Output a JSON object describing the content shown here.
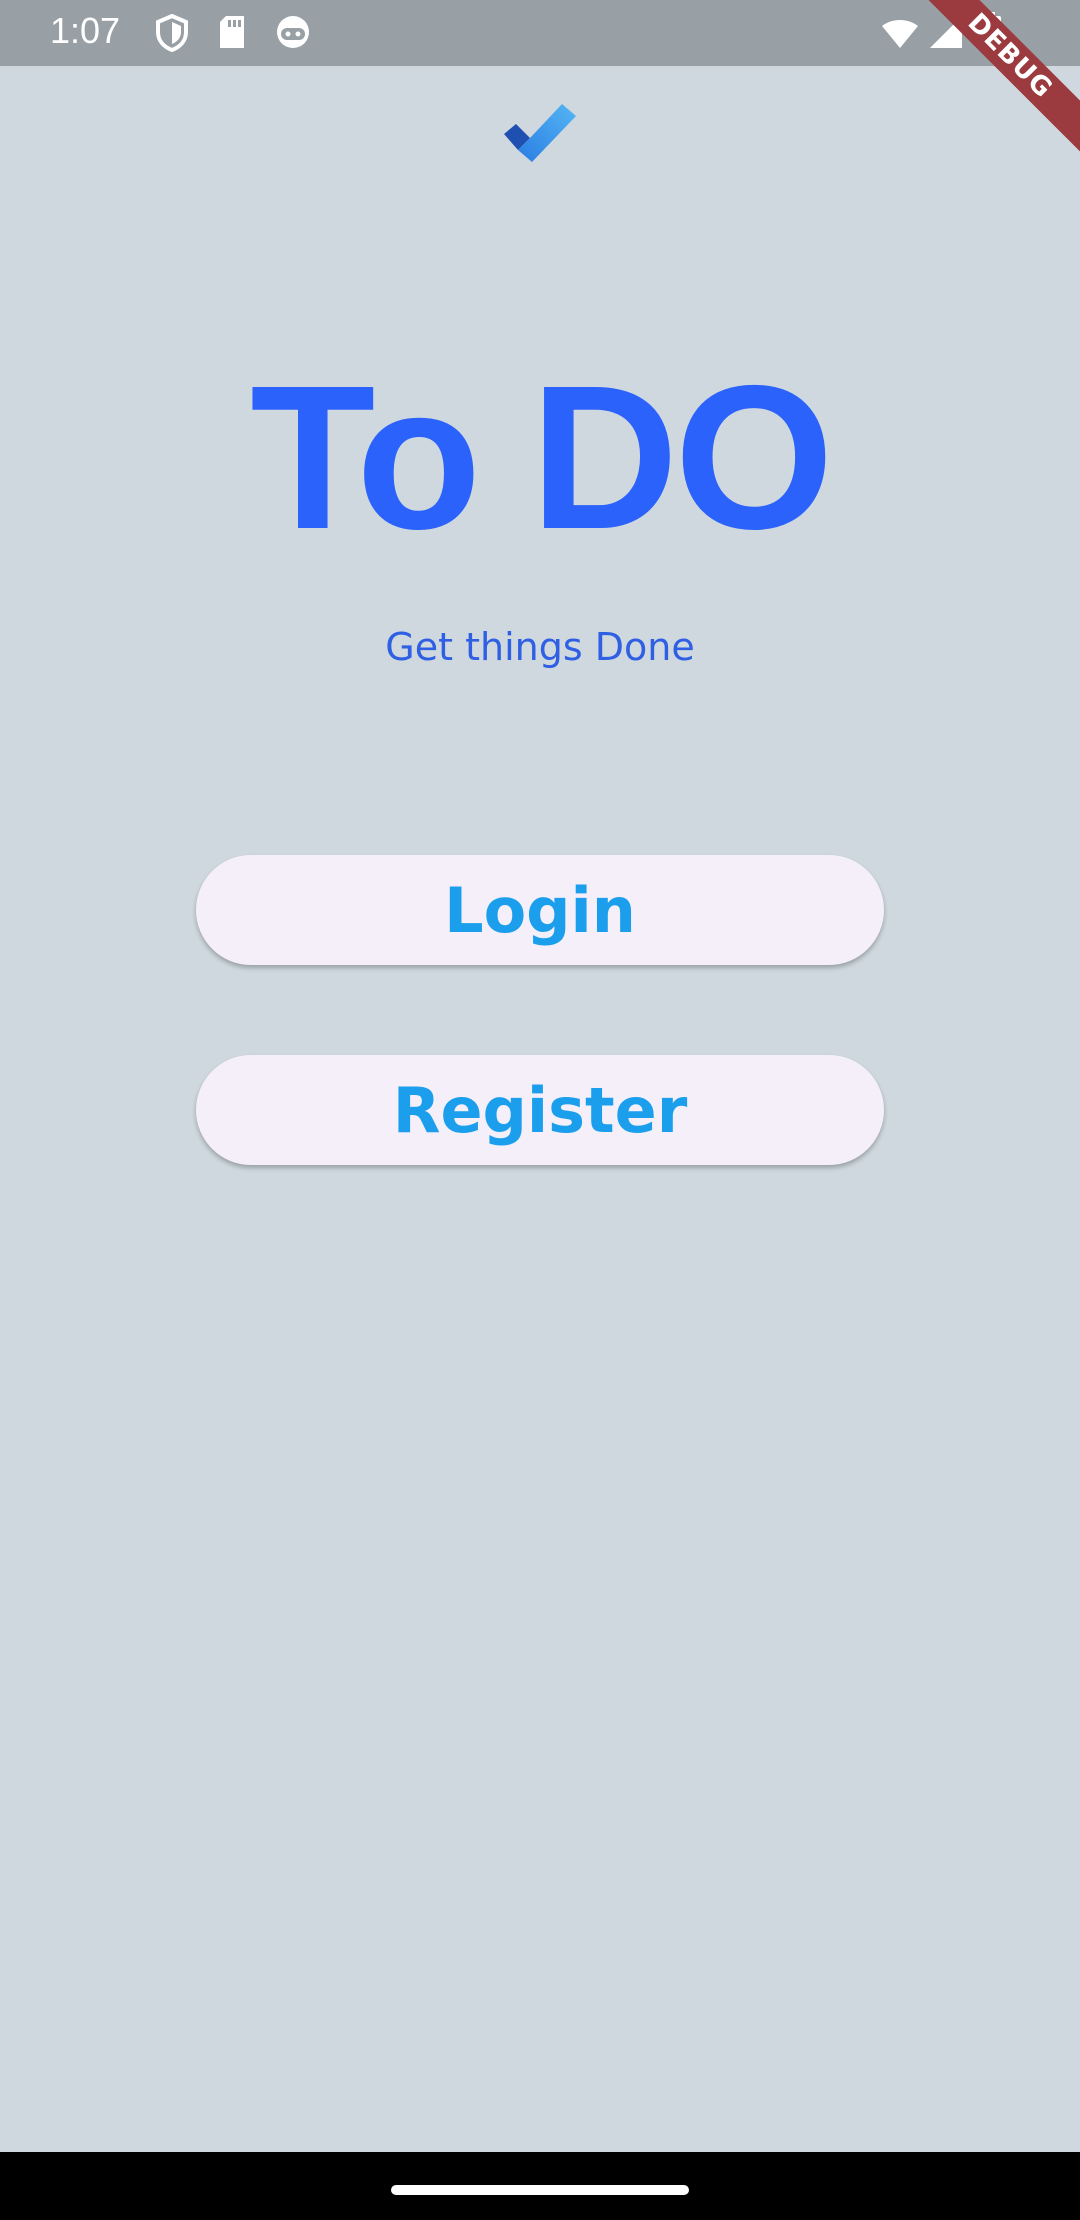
{
  "status_bar": {
    "time": "1:07",
    "icons_left": [
      "shield-icon",
      "sd-card-icon",
      "android-icon"
    ],
    "icons_right": [
      "wifi-icon",
      "signal-icon",
      "battery-icon"
    ]
  },
  "debug_banner": {
    "label": "DEBUG",
    "color": "#9b3a3f"
  },
  "app": {
    "logo": "check-logo-icon",
    "title": "To DO",
    "subtitle": "Get things Done",
    "title_color": "#2b62fb"
  },
  "actions": {
    "login_label": "Login",
    "register_label": "Register",
    "button_text_color": "#1b9fed",
    "button_bg": "#f4eff9"
  },
  "colors": {
    "background": "#cfd8df",
    "status_bar": "#98a0a5",
    "nav_bar": "#000000"
  }
}
